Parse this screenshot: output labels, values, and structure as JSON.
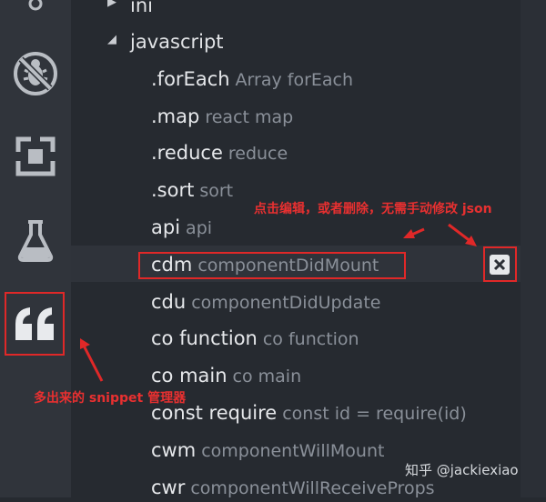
{
  "tree": {
    "folders": [
      {
        "label": "ini",
        "expanded": false
      },
      {
        "label": "javascript",
        "expanded": true
      }
    ]
  },
  "snippets": [
    {
      "prefix": ".forEach",
      "desc": "Array forEach"
    },
    {
      "prefix": ".map",
      "desc": "react map"
    },
    {
      "prefix": ".reduce",
      "desc": "reduce"
    },
    {
      "prefix": ".sort",
      "desc": "sort"
    },
    {
      "prefix": "api",
      "desc": "api"
    },
    {
      "prefix": "cdm",
      "desc": "componentDidMount"
    },
    {
      "prefix": "cdu",
      "desc": "componentDidUpdate"
    },
    {
      "prefix": "co function",
      "desc": "co function"
    },
    {
      "prefix": "co main",
      "desc": "co main"
    },
    {
      "prefix": "const require",
      "desc": "const id = require(id)"
    },
    {
      "prefix": "cwm",
      "desc": "componentWillMount"
    },
    {
      "prefix": "cwr",
      "desc": "componentWillReceiveProps"
    }
  ],
  "annotations": {
    "edit_hint": "点击编辑，或者删除，无需手动修改 json",
    "manager_hint": "多出来的 snippet 管理器"
  },
  "watermark": "知乎 @jackiexiao",
  "icons": {
    "activity": [
      "debug-off-icon",
      "extensions-icon",
      "flask-icon",
      "quote-icon"
    ],
    "delete": "close-icon"
  },
  "colors": {
    "annotation_red": "#e02828",
    "background": "#262a30",
    "activity_bar": "#30343b"
  }
}
